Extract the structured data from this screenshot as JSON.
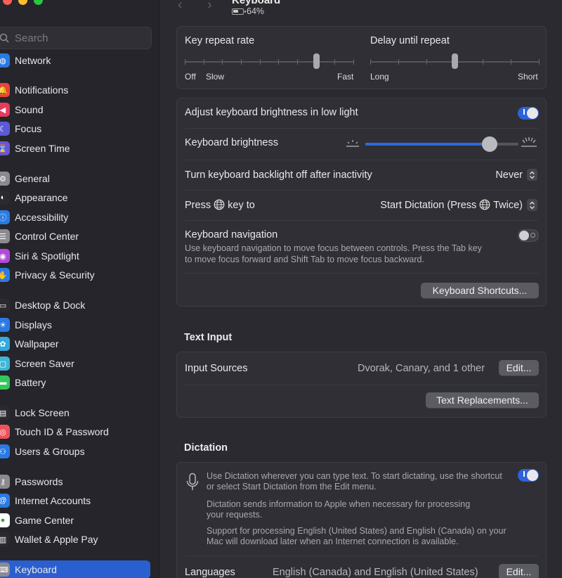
{
  "window": {
    "title": "Keyboard",
    "battery": "64%"
  },
  "search": {
    "placeholder": "Search"
  },
  "sidebar": {
    "items": [
      {
        "label": "Network",
        "icon": "globe-icon",
        "color": "#2a7ae2"
      },
      {
        "label": "Notifications",
        "icon": "bell-icon",
        "color": "#e9443a"
      },
      {
        "label": "Sound",
        "icon": "speaker-icon",
        "color": "#e63b5c"
      },
      {
        "label": "Focus",
        "icon": "moon-icon",
        "color": "#5b5bd6"
      },
      {
        "label": "Screen Time",
        "icon": "hourglass-icon",
        "color": "#6a55d6"
      },
      {
        "label": "General",
        "icon": "gear-icon",
        "color": "#8a8a90"
      },
      {
        "label": "Appearance",
        "icon": "appearance-icon",
        "color": "#2b2b2f"
      },
      {
        "label": "Accessibility",
        "icon": "accessibility-icon",
        "color": "#2a7ae2"
      },
      {
        "label": "Control Center",
        "icon": "control-center-icon",
        "color": "#8a8a90"
      },
      {
        "label": "Siri & Spotlight",
        "icon": "siri-icon",
        "color": "#b04ad8"
      },
      {
        "label": "Privacy & Security",
        "icon": "hand-icon",
        "color": "#2a7ae2"
      },
      {
        "label": "Desktop & Dock",
        "icon": "dock-icon",
        "color": "#2b2b2f"
      },
      {
        "label": "Displays",
        "icon": "sun-icon",
        "color": "#2a7ae2"
      },
      {
        "label": "Wallpaper",
        "icon": "flower-icon",
        "color": "#34aadc"
      },
      {
        "label": "Screen Saver",
        "icon": "screen-saver-icon",
        "color": "#3fb6d6"
      },
      {
        "label": "Battery",
        "icon": "battery-icon",
        "color": "#34c759"
      },
      {
        "label": "Lock Screen",
        "icon": "lock-icon",
        "color": "#2b2b2f"
      },
      {
        "label": "Touch ID & Password",
        "icon": "fingerprint-icon",
        "color": "#e9535a"
      },
      {
        "label": "Users & Groups",
        "icon": "users-icon",
        "color": "#2a7ae2"
      },
      {
        "label": "Passwords",
        "icon": "key-icon",
        "color": "#8a8a90"
      },
      {
        "label": "Internet Accounts",
        "icon": "at-icon",
        "color": "#2a7ae2"
      },
      {
        "label": "Game Center",
        "icon": "game-center-icon",
        "color": "#ffffff"
      },
      {
        "label": "Wallet & Apple Pay",
        "icon": "wallet-icon",
        "color": "#2b2b2f"
      },
      {
        "label": "Keyboard",
        "icon": "keyboard-icon",
        "color": "#8a8a90"
      }
    ]
  },
  "repeat": {
    "key_repeat_label": "Key repeat rate",
    "key_repeat_off": "Off",
    "key_repeat_slow": "Slow",
    "key_repeat_fast": "Fast",
    "key_repeat_value": 7,
    "key_repeat_steps": 9,
    "delay_label": "Delay until repeat",
    "delay_long": "Long",
    "delay_short": "Short",
    "delay_value": 3,
    "delay_steps": 6
  },
  "keyboard": {
    "adjust_brightness_label": "Adjust keyboard brightness in low light",
    "adjust_brightness_on": true,
    "brightness_label": "Keyboard brightness",
    "brightness_level": 0.81,
    "backlight_label": "Turn keyboard backlight off after inactivity",
    "backlight_value": "Never",
    "press_key_prefix": "Press",
    "press_key_suffix": "key to",
    "press_key_value_prefix": "Start Dictation (Press",
    "press_key_value_suffix": "Twice)",
    "navigation_label": "Keyboard navigation",
    "navigation_desc_1": "Use keyboard navigation to move focus between controls. Press the Tab key",
    "navigation_desc_2": "to move focus forward and Shift Tab to move focus backward.",
    "navigation_on": false,
    "shortcuts_button": "Keyboard Shortcuts..."
  },
  "text_input": {
    "section_title": "Text Input",
    "sources_label": "Input Sources",
    "sources_value": "Dvorak, Canary, and 1 other",
    "edit_button": "Edit...",
    "replacements_button": "Text Replacements..."
  },
  "dictation": {
    "section_title": "Dictation",
    "desc_1a": "Use Dictation wherever you can type text. To start dictating, use the shortcut",
    "desc_1b": "or select Start Dictation from the Edit menu.",
    "desc_2a": "Dictation sends information to Apple when necessary for processing",
    "desc_2b": "your requests.",
    "desc_3a": "Support for processing English (United States) and English (Canada) on your",
    "desc_3b": "Mac will download later when an Internet connection is available.",
    "enabled": true,
    "languages_label": "Languages",
    "languages_value": "English (Canada) and English (United States)",
    "edit_button": "Edit..."
  }
}
